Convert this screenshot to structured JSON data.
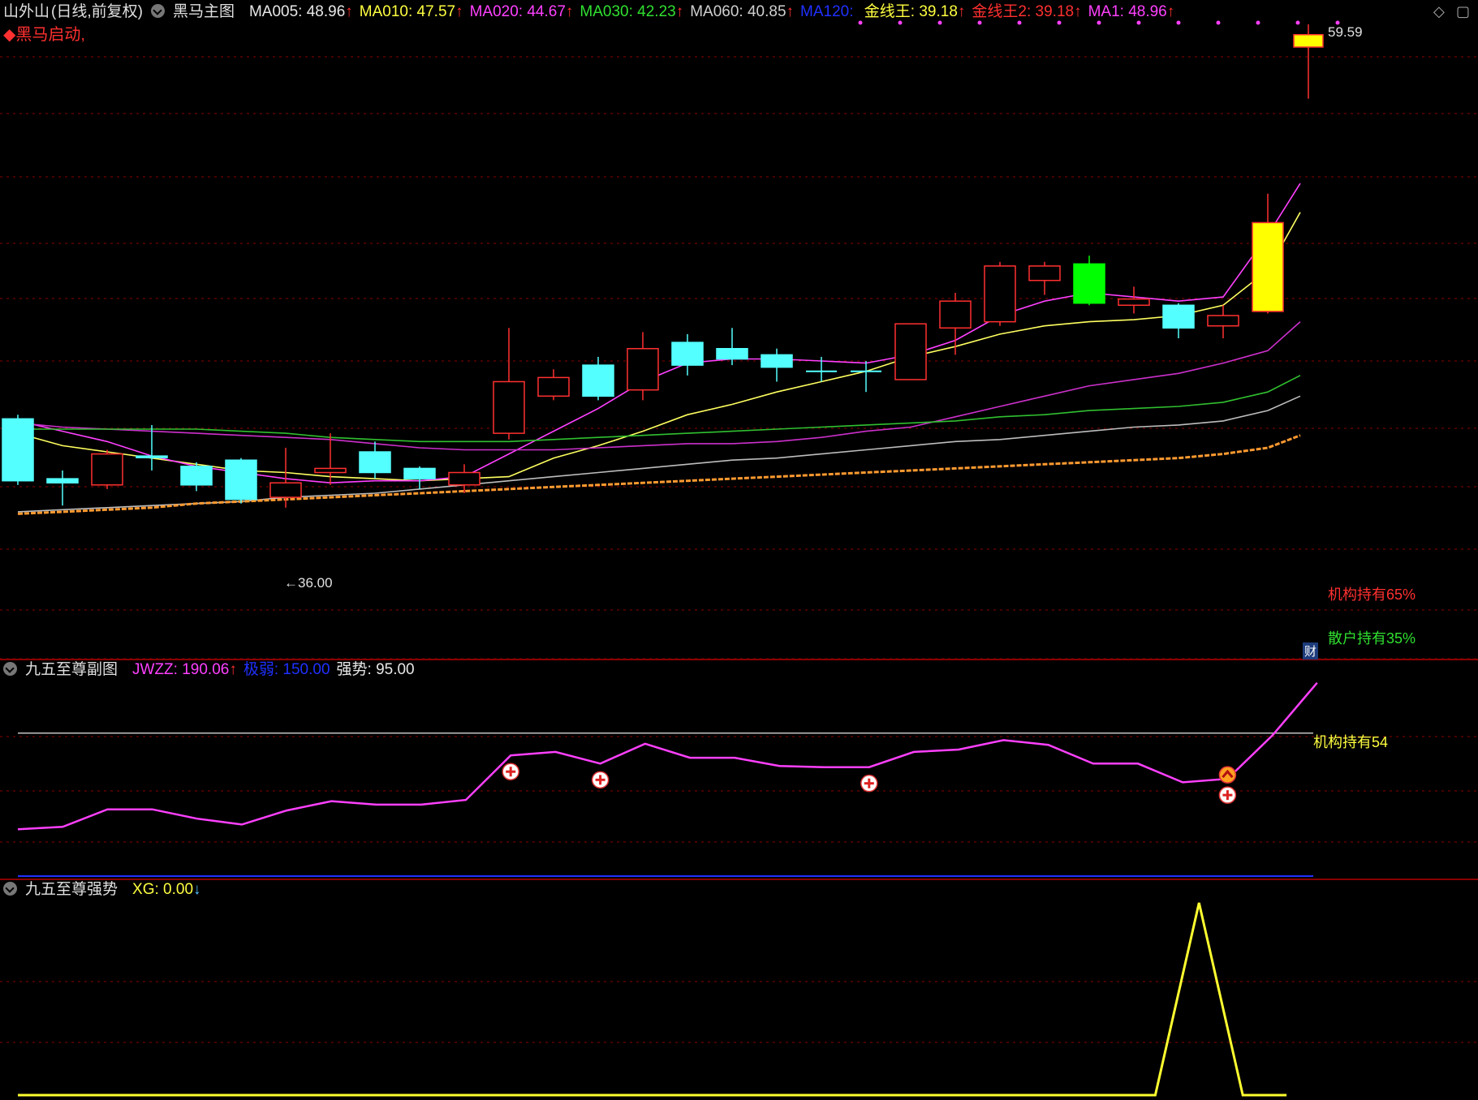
{
  "main_header": {
    "stock_name": "山外山",
    "period": "(日线,前复权)",
    "indicator": "黑马主图",
    "signal_text": "◆黑马启动,",
    "items": [
      {
        "label": "MA005",
        "value": "48.96",
        "arrow": "↑",
        "color": "#e8e8e8"
      },
      {
        "label": "MA010",
        "value": "47.57",
        "arrow": "↑",
        "color": "#ffff40"
      },
      {
        "label": "MA020",
        "value": "44.67",
        "arrow": "↑",
        "color": "#ff40ff"
      },
      {
        "label": "MA030",
        "value": "42.23",
        "arrow": "↑",
        "color": "#30e030"
      },
      {
        "label": "MA060",
        "value": "40.85",
        "arrow": "↑",
        "color": "#cfcfcf"
      },
      {
        "label": "MA120",
        "value": "",
        "arrow": "",
        "color": "#2030ff"
      },
      {
        "label": "金线王",
        "value": "39.18",
        "arrow": "↑",
        "color": "#ffff40"
      },
      {
        "label": "金线王2",
        "value": "39.18",
        "arrow": "↑",
        "color": "#ff3030"
      },
      {
        "label": "MA1",
        "value": "48.96",
        "arrow": "↑",
        "color": "#ff40ff"
      }
    ]
  },
  "sub_header": {
    "indicator": "九五至尊副图",
    "items": [
      {
        "label": "JWZZ",
        "value": "190.06",
        "arrow": "↑",
        "color": "#ff40ff"
      },
      {
        "label": "极弱",
        "value": "150.00",
        "arrow": "",
        "color": "#2030ff"
      },
      {
        "label": "强势",
        "value": "95.00",
        "arrow": "",
        "color": "#e8e8e8"
      }
    ]
  },
  "sub2_header": {
    "indicator": "九五至尊强势",
    "items": [
      {
        "label": "XG",
        "value": "0.00",
        "arrow": "↓",
        "color": "#ffff40"
      }
    ]
  },
  "labels": {
    "high_price": "59.59",
    "low_price": "36.00",
    "inst_hold": "机构持有65%",
    "retail_hold": "散户持有35%",
    "fin_badge": "财",
    "inst_line": "机构持有54"
  },
  "colors": {
    "up": "#ff3030",
    "down_cyan": "#54ffff",
    "limit_yellow": "#ffff00",
    "green_bull": "#00ff00",
    "ma5": "#ff40ff",
    "ma10": "#ffff60",
    "ma20": "#cc30cc",
    "ma30": "#30c030",
    "ma60": "#bdbdbd",
    "gold": "#ff9a30",
    "sub_line": "#ff40ff",
    "xg_line": "#ffff30",
    "grid": "#8b0000",
    "dots": "#ff40ff"
  },
  "chart_data": [
    {
      "type": "candlestick",
      "panel": "main",
      "ylim": [
        33.5,
        60.6
      ],
      "x": [
        1,
        2,
        3,
        4,
        5,
        6,
        7,
        8,
        9,
        10,
        11,
        12,
        13,
        14,
        15,
        16,
        17,
        18,
        19,
        20,
        21,
        22,
        23,
        24,
        25,
        26,
        27,
        28,
        29
      ],
      "candles": [
        {
          "o": 41.5,
          "h": 41.7,
          "l": 38.3,
          "c": 38.5,
          "style": "cyan"
        },
        {
          "o": 38.6,
          "h": 39.0,
          "l": 37.3,
          "c": 38.4,
          "style": "cyan"
        },
        {
          "o": 38.3,
          "h": 40.0,
          "l": 38.1,
          "c": 39.8,
          "style": "up"
        },
        {
          "o": 39.7,
          "h": 41.2,
          "l": 39.0,
          "c": 39.7,
          "style": "cyan"
        },
        {
          "o": 39.2,
          "h": 39.4,
          "l": 38.0,
          "c": 38.3,
          "style": "cyan"
        },
        {
          "o": 39.5,
          "h": 39.6,
          "l": 37.4,
          "c": 37.6,
          "style": "cyan"
        },
        {
          "o": 37.7,
          "h": 40.1,
          "l": 37.2,
          "c": 38.4,
          "style": "up"
        },
        {
          "o": 38.9,
          "h": 40.8,
          "l": 38.3,
          "c": 39.1,
          "style": "up"
        },
        {
          "o": 39.9,
          "h": 40.4,
          "l": 38.6,
          "c": 38.9,
          "style": "cyan"
        },
        {
          "o": 39.1,
          "h": 39.2,
          "l": 38.1,
          "c": 38.6,
          "style": "cyan"
        },
        {
          "o": 38.3,
          "h": 39.3,
          "l": 37.9,
          "c": 38.9,
          "style": "up"
        },
        {
          "o": 40.8,
          "h": 45.9,
          "l": 40.5,
          "c": 43.3,
          "style": "up"
        },
        {
          "o": 42.6,
          "h": 43.9,
          "l": 42.4,
          "c": 43.5,
          "style": "up"
        },
        {
          "o": 44.1,
          "h": 44.5,
          "l": 42.4,
          "c": 42.6,
          "style": "cyan"
        },
        {
          "o": 42.9,
          "h": 45.7,
          "l": 42.4,
          "c": 44.9,
          "style": "up"
        },
        {
          "o": 45.2,
          "h": 45.6,
          "l": 43.6,
          "c": 44.1,
          "style": "cyan"
        },
        {
          "o": 44.9,
          "h": 45.9,
          "l": 44.1,
          "c": 44.4,
          "style": "cyan"
        },
        {
          "o": 44.6,
          "h": 44.9,
          "l": 43.3,
          "c": 44.0,
          "style": "cyan"
        },
        {
          "o": 43.8,
          "h": 44.5,
          "l": 43.3,
          "c": 43.8,
          "style": "doji"
        },
        {
          "o": 43.8,
          "h": 44.3,
          "l": 42.8,
          "c": 43.8,
          "style": "doji"
        },
        {
          "o": 43.4,
          "h": 46.1,
          "l": 43.4,
          "c": 46.1,
          "style": "up"
        },
        {
          "o": 45.9,
          "h": 47.6,
          "l": 44.6,
          "c": 47.2,
          "style": "up"
        },
        {
          "o": 46.2,
          "h": 49.1,
          "l": 46.0,
          "c": 48.9,
          "style": "up"
        },
        {
          "o": 48.2,
          "h": 49.1,
          "l": 47.5,
          "c": 48.9,
          "style": "up"
        },
        {
          "o": 49.0,
          "h": 49.4,
          "l": 47.0,
          "c": 47.1,
          "style": "green"
        },
        {
          "o": 47.0,
          "h": 47.9,
          "l": 46.6,
          "c": 47.3,
          "style": "up"
        },
        {
          "o": 47.0,
          "h": 47.1,
          "l": 45.4,
          "c": 45.9,
          "style": "cyan"
        },
        {
          "o": 46.0,
          "h": 47.0,
          "l": 45.4,
          "c": 46.5,
          "style": "up"
        },
        {
          "o": 46.7,
          "h": 52.4,
          "l": 46.6,
          "c": 51.0,
          "style": "limit"
        }
      ],
      "lines": [
        {
          "key": "ma10",
          "values": [
            40.8,
            40.2,
            39.9,
            39.6,
            39.3,
            39.0,
            38.9,
            38.7,
            38.6,
            38.5,
            38.6,
            38.7,
            39.6,
            40.2,
            40.9,
            41.7,
            42.2,
            42.8,
            43.3,
            43.8,
            44.5,
            45.0,
            45.6,
            46.0,
            46.2,
            46.3,
            46.5,
            47.0,
            48.7
          ]
        },
        {
          "key": "ma5",
          "values": [
            41.4,
            40.9,
            40.4,
            39.7,
            39.2,
            38.9,
            38.6,
            38.4,
            38.5,
            38.5,
            38.7,
            39.8,
            40.9,
            42.0,
            43.3,
            44.2,
            44.4,
            44.4,
            44.3,
            44.2,
            44.6,
            45.3,
            46.5,
            47.2,
            47.6,
            47.4,
            47.2,
            47.4,
            50.4
          ]
        },
        {
          "key": "ma20",
          "values": [
            41.3,
            41.1,
            41.0,
            40.9,
            40.8,
            40.7,
            40.6,
            40.5,
            40.3,
            40.1,
            40.0,
            40.0,
            40.0,
            40.1,
            40.2,
            40.3,
            40.3,
            40.4,
            40.6,
            40.9,
            41.1,
            41.6,
            42.1,
            42.6,
            43.1,
            43.4,
            43.7,
            44.2,
            44.8
          ]
        },
        {
          "key": "ma30",
          "values": [
            41.0,
            41.0,
            41.0,
            41.0,
            41.0,
            40.9,
            40.8,
            40.6,
            40.5,
            40.4,
            40.4,
            40.4,
            40.5,
            40.6,
            40.7,
            40.8,
            40.9,
            41.0,
            41.1,
            41.2,
            41.3,
            41.4,
            41.6,
            41.7,
            41.9,
            42.0,
            42.1,
            42.3,
            42.8
          ]
        },
        {
          "key": "ma60",
          "values": [
            37.0,
            37.1,
            37.2,
            37.3,
            37.4,
            37.5,
            37.7,
            37.8,
            37.9,
            38.1,
            38.3,
            38.5,
            38.7,
            38.9,
            39.1,
            39.3,
            39.5,
            39.6,
            39.8,
            40.0,
            40.2,
            40.4,
            40.5,
            40.7,
            40.9,
            41.1,
            41.2,
            41.4,
            41.9
          ]
        },
        {
          "key": "gold",
          "values": [
            36.9,
            37.0,
            37.1,
            37.2,
            37.4,
            37.5,
            37.6,
            37.7,
            37.8,
            37.9,
            38.0,
            38.1,
            38.2,
            38.3,
            38.4,
            38.5,
            38.6,
            38.7,
            38.8,
            38.9,
            39.0,
            39.1,
            39.2,
            39.3,
            39.4,
            39.5,
            39.6,
            39.8,
            40.1
          ]
        }
      ],
      "ma5_extra_last": 52.9,
      "ma10_extra_last": 51.5,
      "ma20_extra_last": 46.2,
      "ma30_extra_last": 43.6,
      "ma60_extra_last": 42.6,
      "gold_extra_last": 40.7,
      "spike": {
        "h": 60.6,
        "l": 57.0,
        "box_top": 60.1,
        "box_bot": 59.5
      },
      "high_marker": {
        "value": 59.59
      },
      "low_marker": {
        "value": 36.0
      }
    },
    {
      "type": "line",
      "panel": "sub",
      "ylim": [
        25,
        205
      ],
      "x": [
        1,
        2,
        3,
        4,
        5,
        6,
        7,
        8,
        9,
        10,
        11,
        12,
        13,
        14,
        15,
        16,
        17,
        18,
        19,
        20,
        21,
        22,
        23,
        24,
        25,
        26,
        27,
        28,
        29,
        30
      ],
      "series": [
        {
          "key": "jwzz",
          "values": [
            65,
            67,
            82,
            82,
            74,
            69,
            81,
            89,
            86,
            86,
            90,
            128,
            131,
            121,
            138,
            126,
            126,
            119,
            118,
            118,
            131,
            133,
            141,
            137,
            121,
            121,
            105,
            108,
            145,
            190
          ]
        }
      ],
      "hline": 147,
      "plus_markers": [
        12,
        14,
        20,
        28
      ],
      "up_marker": 28
    },
    {
      "type": "line",
      "panel": "sub2",
      "ylim": [
        0,
        1
      ],
      "x": [
        1,
        2,
        3,
        4,
        5,
        6,
        7,
        8,
        9,
        10,
        11,
        12,
        13,
        14,
        15,
        16,
        17,
        18,
        19,
        20,
        21,
        22,
        23,
        24,
        25,
        26,
        27,
        28,
        29,
        30
      ],
      "series": [
        {
          "key": "xg",
          "values": [
            0,
            0,
            0,
            0,
            0,
            0,
            0,
            0,
            0,
            0,
            0,
            0,
            0,
            0,
            0,
            0,
            0,
            0,
            0,
            0,
            0,
            0,
            0,
            0,
            0,
            0,
            0,
            1,
            0,
            0
          ]
        }
      ]
    }
  ]
}
